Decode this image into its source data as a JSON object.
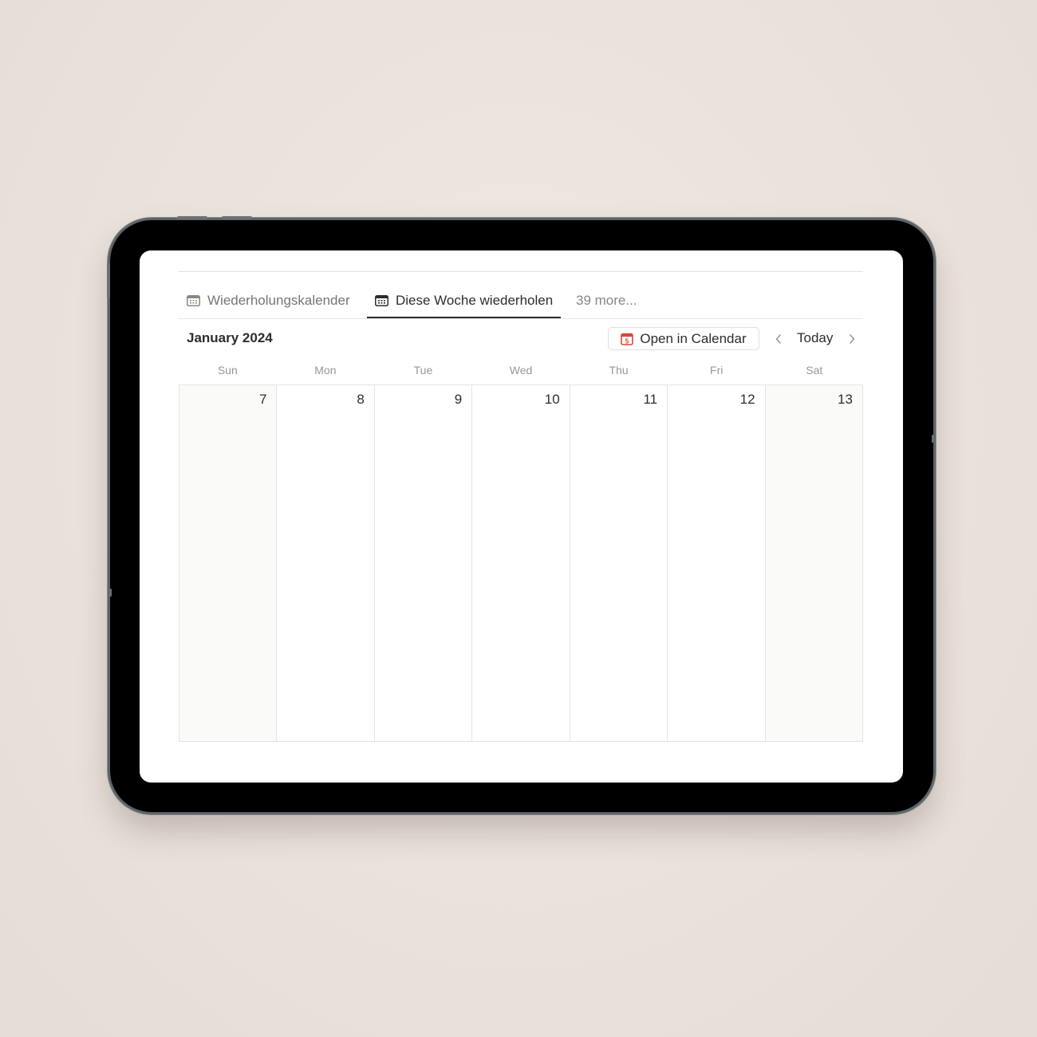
{
  "tabs": [
    {
      "label": "Wiederholungskalender",
      "icon": "calendar-icon"
    },
    {
      "label": "Diese Woche wiederholen",
      "icon": "calendar-icon"
    }
  ],
  "more_label": "39 more...",
  "header": {
    "month": "January 2024",
    "open_calendar_label": "Open in Calendar",
    "open_calendar_icon_text": "5",
    "today_label": "Today"
  },
  "weekdays": [
    "Sun",
    "Mon",
    "Tue",
    "Wed",
    "Thu",
    "Fri",
    "Sat"
  ],
  "days": [
    "7",
    "8",
    "9",
    "10",
    "11",
    "12",
    "13"
  ],
  "colors": {
    "accent_red": "#d9473a",
    "text": "#2f2d2a",
    "muted": "#787570"
  }
}
